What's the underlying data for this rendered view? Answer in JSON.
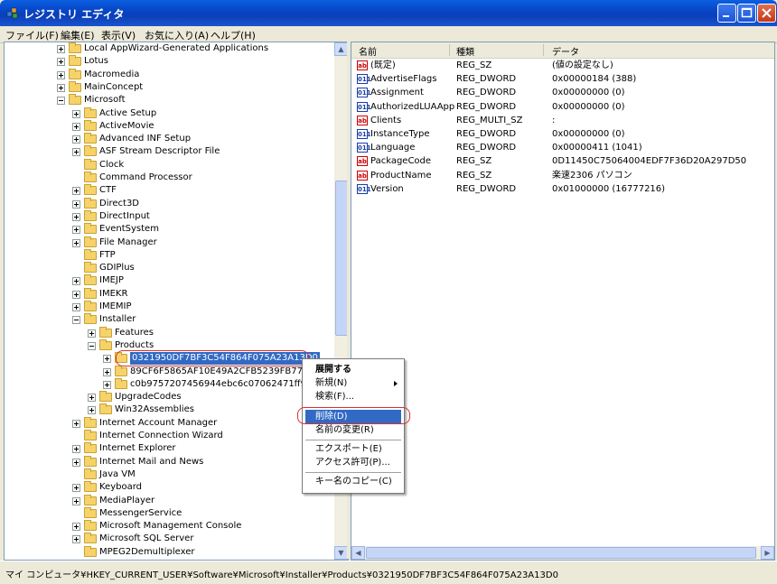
{
  "window": {
    "title": "レジストリ エディタ"
  },
  "menubar": [
    "ファイル(F)",
    "編集(E)",
    "表示(V)",
    "お気に入り(A)",
    "ヘルプ(H)"
  ],
  "tree": [
    {
      "label": "Local AppWizard-Generated Applications",
      "indent": 0,
      "exp": "plus"
    },
    {
      "label": "Lotus",
      "indent": 0,
      "exp": "plus"
    },
    {
      "label": "Macromedia",
      "indent": 0,
      "exp": "plus"
    },
    {
      "label": "MainConcept",
      "indent": 0,
      "exp": "plus"
    },
    {
      "label": "Microsoft",
      "indent": 0,
      "exp": "minus"
    },
    {
      "label": "Active Setup",
      "indent": 1,
      "exp": "plus"
    },
    {
      "label": "ActiveMovie",
      "indent": 1,
      "exp": "plus"
    },
    {
      "label": "Advanced INF Setup",
      "indent": 1,
      "exp": "plus"
    },
    {
      "label": "ASF Stream Descriptor File",
      "indent": 1,
      "exp": "plus"
    },
    {
      "label": "Clock",
      "indent": 1,
      "exp": "none"
    },
    {
      "label": "Command Processor",
      "indent": 1,
      "exp": "none"
    },
    {
      "label": "CTF",
      "indent": 1,
      "exp": "plus"
    },
    {
      "label": "Direct3D",
      "indent": 1,
      "exp": "plus"
    },
    {
      "label": "DirectInput",
      "indent": 1,
      "exp": "plus"
    },
    {
      "label": "EventSystem",
      "indent": 1,
      "exp": "plus"
    },
    {
      "label": "File Manager",
      "indent": 1,
      "exp": "plus"
    },
    {
      "label": "FTP",
      "indent": 1,
      "exp": "none"
    },
    {
      "label": "GDIPlus",
      "indent": 1,
      "exp": "none"
    },
    {
      "label": "IMEJP",
      "indent": 1,
      "exp": "plus"
    },
    {
      "label": "IMEKR",
      "indent": 1,
      "exp": "plus"
    },
    {
      "label": "IMEMIP",
      "indent": 1,
      "exp": "plus"
    },
    {
      "label": "Installer",
      "indent": 1,
      "exp": "minus"
    },
    {
      "label": "Features",
      "indent": 2,
      "exp": "plus"
    },
    {
      "label": "Products",
      "indent": 2,
      "exp": "minus"
    },
    {
      "label": "0321950DF7BF3C54F864F075A23A13D0",
      "indent": 3,
      "exp": "plus",
      "selected": true
    },
    {
      "label": "89CF6F5865AF10E49A2CFB5239FB775B",
      "indent": 3,
      "exp": "plus"
    },
    {
      "label": "c0b9757207456944ebc6c07062471ff9",
      "indent": 3,
      "exp": "plus"
    },
    {
      "label": "UpgradeCodes",
      "indent": 2,
      "exp": "plus"
    },
    {
      "label": "Win32Assemblies",
      "indent": 2,
      "exp": "plus"
    },
    {
      "label": "Internet Account Manager",
      "indent": 1,
      "exp": "plus"
    },
    {
      "label": "Internet Connection Wizard",
      "indent": 1,
      "exp": "none"
    },
    {
      "label": "Internet Explorer",
      "indent": 1,
      "exp": "plus"
    },
    {
      "label": "Internet Mail and News",
      "indent": 1,
      "exp": "plus"
    },
    {
      "label": "Java VM",
      "indent": 1,
      "exp": "none"
    },
    {
      "label": "Keyboard",
      "indent": 1,
      "exp": "plus"
    },
    {
      "label": "MediaPlayer",
      "indent": 1,
      "exp": "plus"
    },
    {
      "label": "MessengerService",
      "indent": 1,
      "exp": "none"
    },
    {
      "label": "Microsoft Management Console",
      "indent": 1,
      "exp": "plus"
    },
    {
      "label": "Microsoft SQL Server",
      "indent": 1,
      "exp": "plus"
    },
    {
      "label": "MPEG2Demultiplexer",
      "indent": 1,
      "exp": "none"
    }
  ],
  "list": {
    "headers": [
      "名前",
      "種類",
      "データ"
    ],
    "rows": [
      {
        "icon": "ab",
        "name": "(既定)",
        "type": "REG_SZ",
        "data": "(値の設定なし)"
      },
      {
        "icon": "bin",
        "name": "AdvertiseFlags",
        "type": "REG_DWORD",
        "data": "0x00000184 (388)"
      },
      {
        "icon": "bin",
        "name": "Assignment",
        "type": "REG_DWORD",
        "data": "0x00000000 (0)"
      },
      {
        "icon": "bin",
        "name": "AuthorizedLUAApp",
        "type": "REG_DWORD",
        "data": "0x00000000 (0)"
      },
      {
        "icon": "ab",
        "name": "Clients",
        "type": "REG_MULTI_SZ",
        "data": ":"
      },
      {
        "icon": "bin",
        "name": "InstanceType",
        "type": "REG_DWORD",
        "data": "0x00000000 (0)"
      },
      {
        "icon": "bin",
        "name": "Language",
        "type": "REG_DWORD",
        "data": "0x00000411 (1041)"
      },
      {
        "icon": "ab",
        "name": "PackageCode",
        "type": "REG_SZ",
        "data": "0D11450C75064004EDF7F36D20A297D50"
      },
      {
        "icon": "ab",
        "name": "ProductName",
        "type": "REG_SZ",
        "data": "楽速2306 パソコン"
      },
      {
        "icon": "bin",
        "name": "Version",
        "type": "REG_DWORD",
        "data": "0x01000000 (16777216)"
      }
    ]
  },
  "context_menu": {
    "items": [
      "展開する",
      "新規(N)",
      "検索(F)...",
      "削除(D)",
      "名前の変更(R)",
      "エクスポート(E)",
      "アクセス許可(P)...",
      "キー名のコピー(C)"
    ]
  },
  "status": {
    "path": "マイ コンピュータ¥HKEY_CURRENT_USER¥Software¥Microsoft¥Installer¥Products¥0321950DF7BF3C54F864F075A23A13D0"
  },
  "colors": {
    "selection": "#316ac5",
    "highlight_ring": "#d9302a",
    "titlebar": "#0a5fe0"
  }
}
